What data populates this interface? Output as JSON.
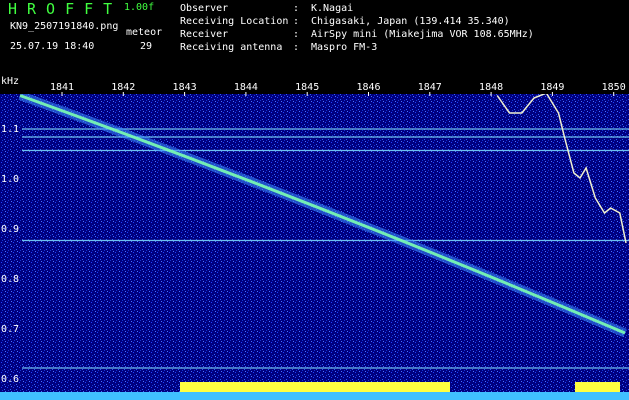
{
  "header": {
    "app_title": "HROFFT",
    "version": "1.00f",
    "filename": "KN9_2507191840.png",
    "datetime": "25.07.19 18:40",
    "mode_label": "meteor",
    "mode_count": "29",
    "info": [
      {
        "key": "Observer",
        "sep": ":",
        "value": "K.Nagai"
      },
      {
        "key": "Receiving Location",
        "sep": ":",
        "value": "Chigasaki, Japan (139.414 35.340)"
      },
      {
        "key": "Receiver",
        "sep": ":",
        "value": "AirSpy mini (Miakejima VOR 108.65MHz)"
      },
      {
        "key": "Receiving antenna",
        "sep": ":",
        "value": "Maspro FM-3"
      }
    ]
  },
  "chart_data": {
    "type": "heatmap",
    "ylabel": "kHz",
    "x_ticks": [
      "1841",
      "1842",
      "1843",
      "1844",
      "1845",
      "1846",
      "1847",
      "1848",
      "1849",
      "1850"
    ],
    "y_ticks": [
      "1.1",
      "1.0",
      "0.9",
      "0.8",
      "0.7",
      "0.6"
    ],
    "ylim": [
      0.58,
      1.18
    ],
    "colors": {
      "background": "#000080",
      "noise": "#1e3cff",
      "trace": "#7cffb0",
      "line": "#80e0ff",
      "text": "#ffffff",
      "signal_bar": "#ffff40",
      "baseline": "#40c0ff"
    },
    "doppler_trace": {
      "start_khz": 1.165,
      "end_khz": 0.69
    },
    "carrier_lines_khz": [
      1.098,
      1.082,
      1.055,
      0.875,
      0.62
    ],
    "curve_points": [
      {
        "t": 1848.1,
        "khz": 1.165
      },
      {
        "t": 1848.3,
        "khz": 1.13
      },
      {
        "t": 1848.5,
        "khz": 1.13
      },
      {
        "t": 1848.7,
        "khz": 1.16
      },
      {
        "t": 1848.9,
        "khz": 1.17
      },
      {
        "t": 1849.1,
        "khz": 1.13
      },
      {
        "t": 1849.2,
        "khz": 1.08
      },
      {
        "t": 1849.35,
        "khz": 1.01
      },
      {
        "t": 1849.45,
        "khz": 1.0
      },
      {
        "t": 1849.55,
        "khz": 1.02
      },
      {
        "t": 1849.7,
        "khz": 0.96
      },
      {
        "t": 1849.85,
        "khz": 0.93
      },
      {
        "t": 1849.95,
        "khz": 0.94
      },
      {
        "t": 1850.1,
        "khz": 0.93
      },
      {
        "t": 1850.2,
        "khz": 0.87
      }
    ]
  }
}
